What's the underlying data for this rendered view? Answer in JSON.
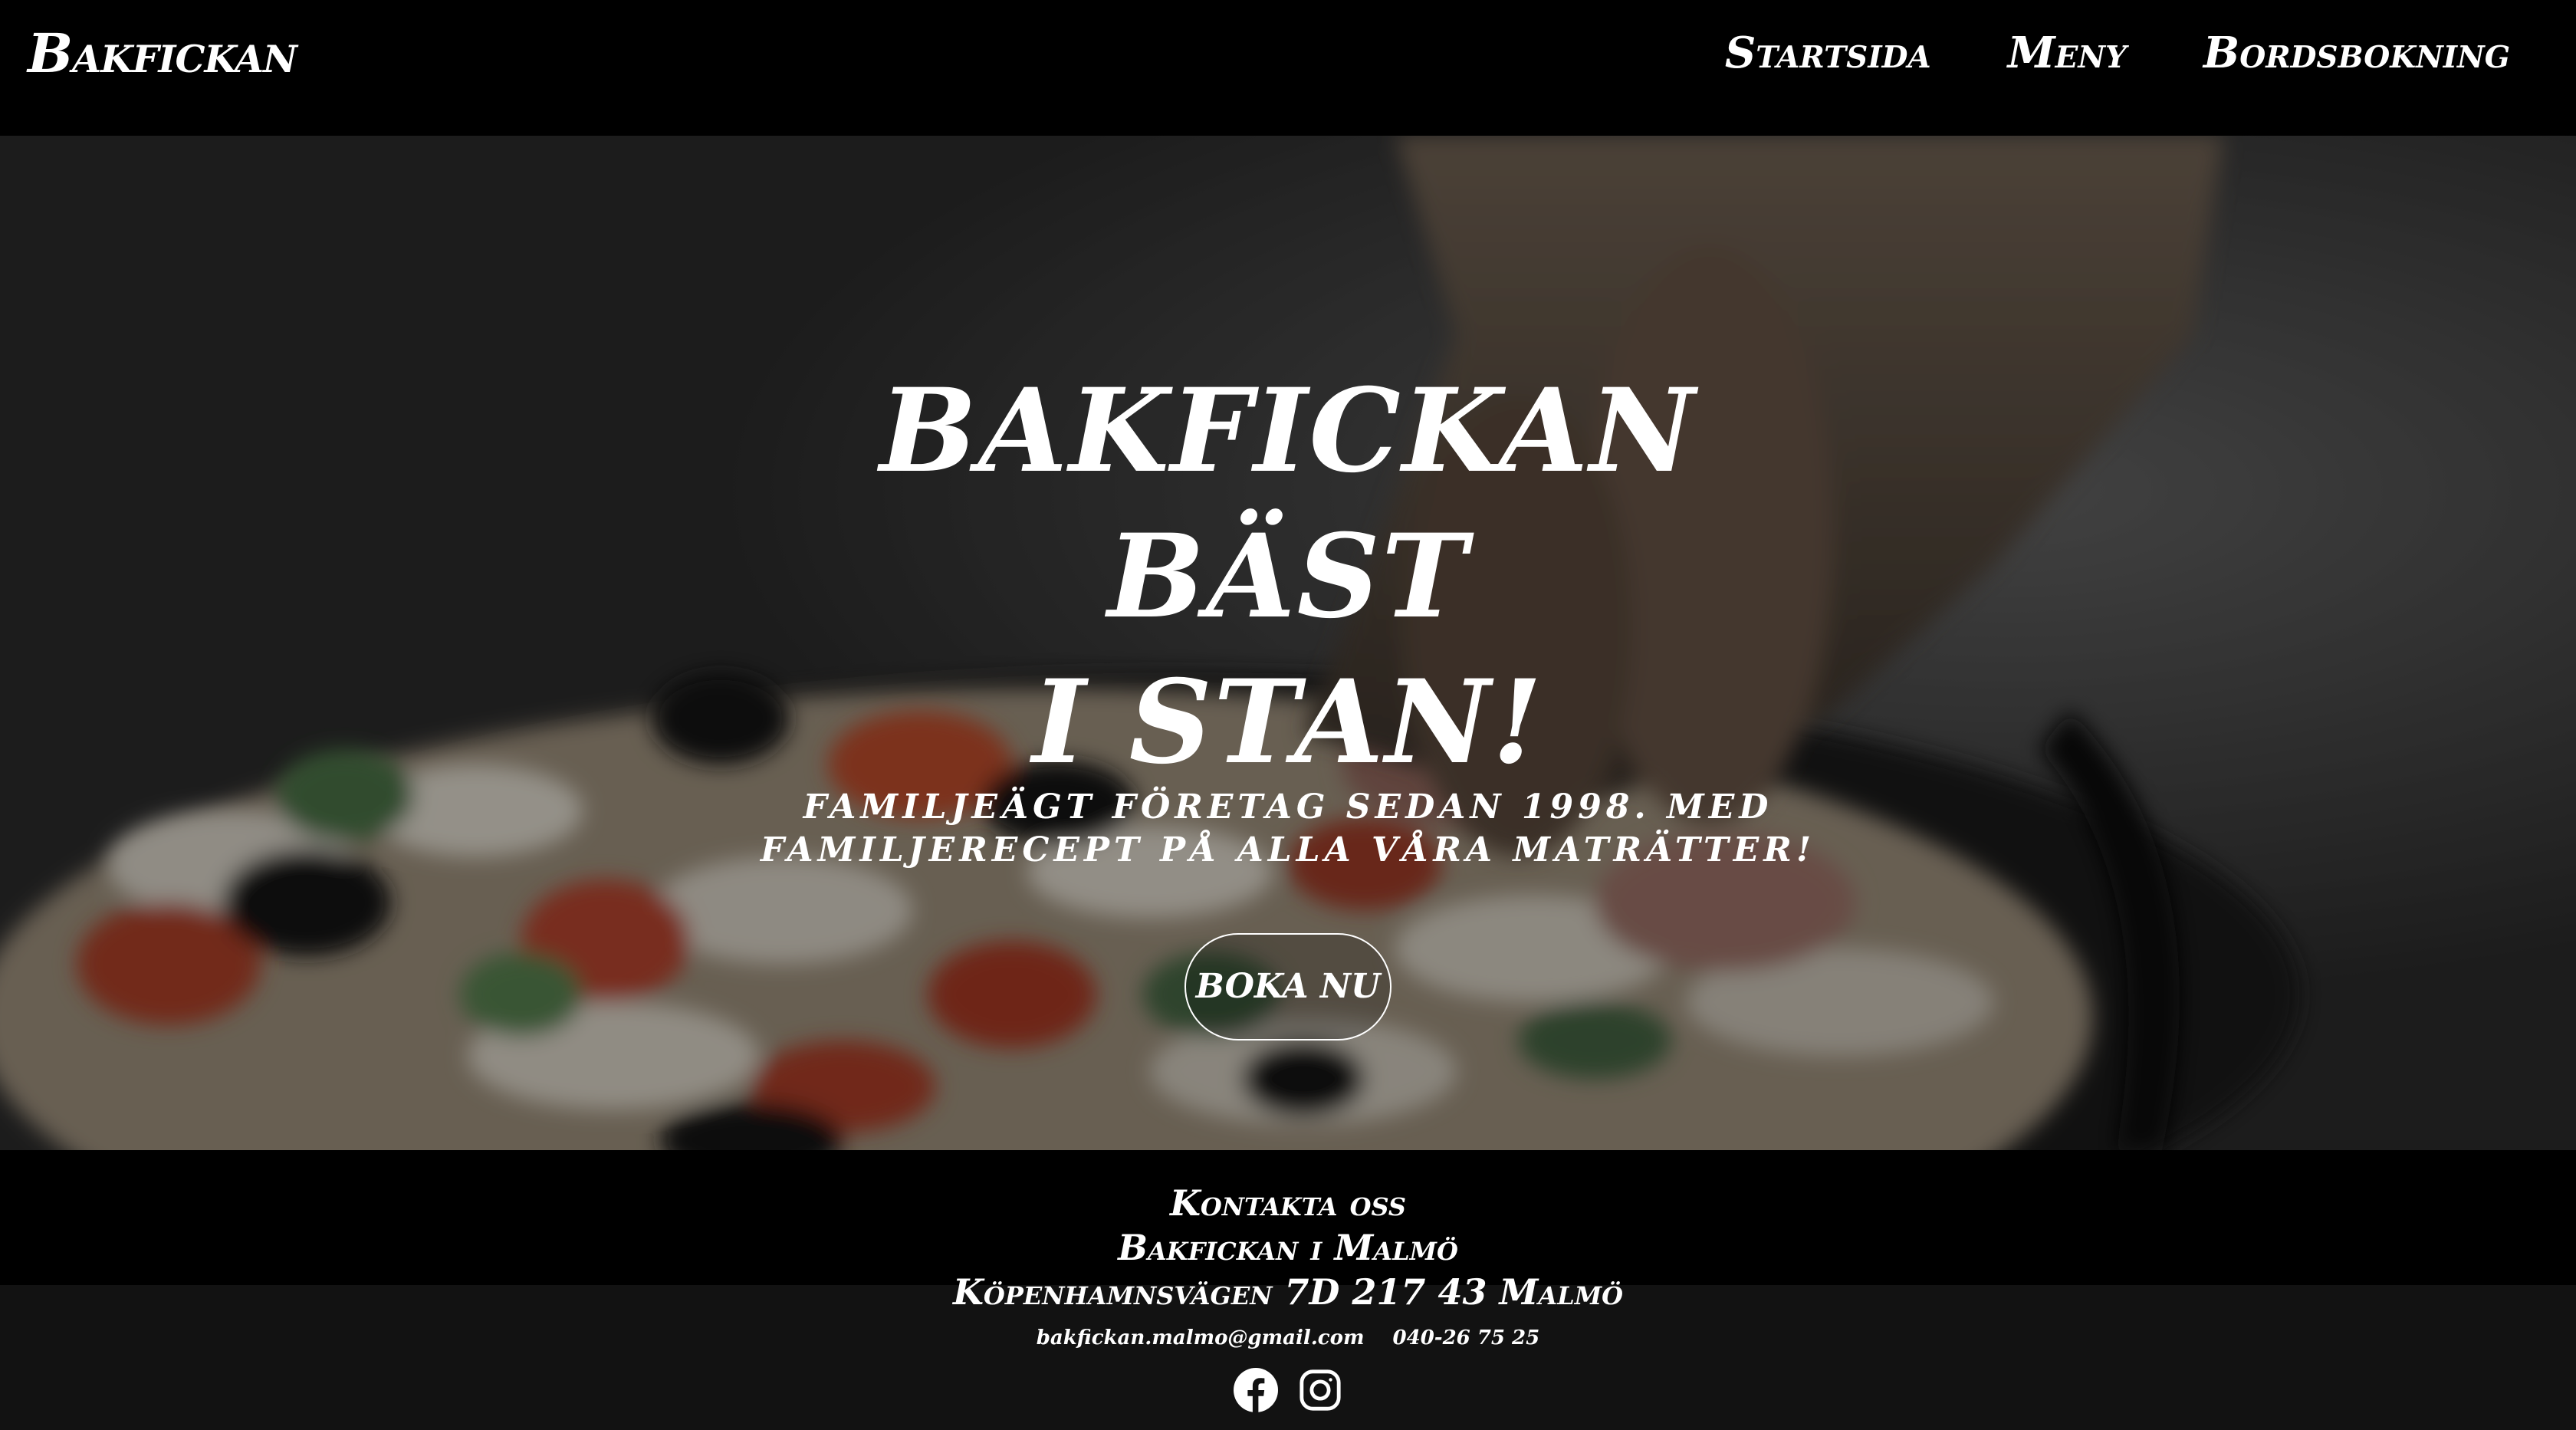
{
  "header": {
    "brand": "Bakfickan",
    "nav": [
      {
        "label": "Startsida"
      },
      {
        "label": "Meny"
      },
      {
        "label": "Bordsbokning"
      }
    ]
  },
  "hero": {
    "title_lines": [
      "BAKFICKAN",
      "BÄST",
      "I STAN!"
    ],
    "tagline": "FAMILJEÄGT FÖRETAG SEDAN 1998. MED FAMILJERECEPT PÅ ALLA VÅRA MATRÄTTER!",
    "cta_label": "BOKA NU"
  },
  "footer": {
    "contact_heading": "Kontakta oss",
    "name": "Bakfickan i Malmö",
    "address": "Köpenhamnsvägen 7D 217 43 Malmö",
    "email": "bakfickan.malmo@gmail.com",
    "phone": "040-26 75 25",
    "socials": [
      {
        "icon": "facebook-icon"
      },
      {
        "icon": "instagram-icon"
      }
    ]
  },
  "colors": {
    "header_bg": "#000000",
    "footer_bg": "#000000",
    "page_bg": "#121212",
    "text": "#ffffff"
  }
}
